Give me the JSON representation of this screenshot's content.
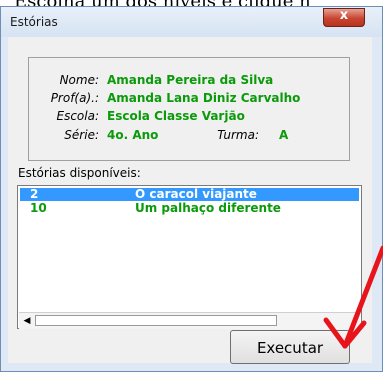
{
  "top_text": "Escolha um dos níveis e clique n",
  "window": {
    "title": "Estórias",
    "close_glyph": "x"
  },
  "student_info": {
    "name_label": "Nome:",
    "name_value": "Amanda Pereira da Silva",
    "teacher_label": "Prof(a).:",
    "teacher_value": "Amanda Lana Diniz Carvalho",
    "school_label": "Escola:",
    "school_value": "Escola Classe Varjão",
    "grade_label": "Série:",
    "grade_value": "4o. Ano",
    "class_label": "Turma:",
    "class_value": "A"
  },
  "stories": {
    "label": "Estórias disponíveis:",
    "items": [
      {
        "number": "2",
        "title": "O caracol viajante",
        "selected": true
      },
      {
        "number": "10",
        "title": "Um palhaço diferente",
        "selected": false
      }
    ]
  },
  "execute_button": {
    "label": "Executar"
  },
  "colors": {
    "value_green": "#0a9a0a",
    "selection_blue": "#3399ff",
    "arrow_red": "#e8141b"
  }
}
